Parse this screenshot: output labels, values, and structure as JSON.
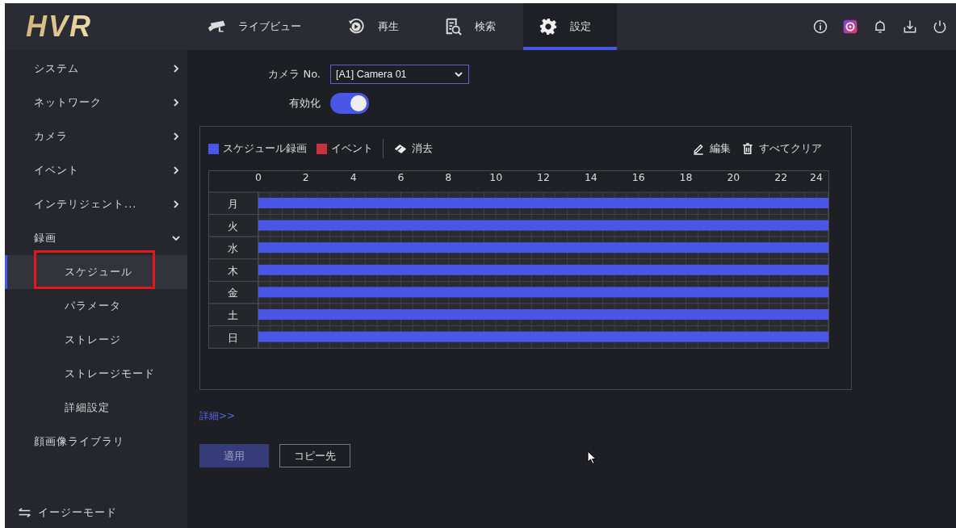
{
  "header": {
    "logo": "HVR",
    "tabs": [
      {
        "kind": "live",
        "label": "ライブビュー",
        "selected": false
      },
      {
        "kind": "playback",
        "label": "再生",
        "selected": false
      },
      {
        "kind": "search",
        "label": "検索",
        "selected": false
      },
      {
        "kind": "settings",
        "label": "設定",
        "selected": true
      }
    ]
  },
  "sidebar": {
    "items": [
      {
        "label": "システム",
        "kind": "group",
        "expanded": false
      },
      {
        "label": "ネットワーク",
        "kind": "group",
        "expanded": false
      },
      {
        "label": "カメラ",
        "kind": "group",
        "expanded": false
      },
      {
        "label": "イベント",
        "kind": "group",
        "expanded": false
      },
      {
        "label": "インテリジェント...",
        "kind": "group",
        "expanded": false
      },
      {
        "label": "録画",
        "kind": "group",
        "expanded": true,
        "children": [
          {
            "label": "スケジュール",
            "selected": true
          },
          {
            "label": "パラメータ",
            "selected": false
          },
          {
            "label": "ストレージ",
            "selected": false
          },
          {
            "label": "ストレージモード",
            "selected": false
          },
          {
            "label": "詳細設定",
            "selected": false
          }
        ]
      },
      {
        "label": "顔画像ライブラリ",
        "kind": "link"
      }
    ],
    "footer": "イージーモード"
  },
  "form": {
    "camera_label": "カメラ No.",
    "camera_value": "[A1] Camera 01",
    "enable_label": "有効化",
    "enabled": true
  },
  "schedule": {
    "legend_extra": [
      {
        "label": "イベント",
        "color": "#c8323c"
      }
    ],
    "erase": "消去",
    "edit": "編集",
    "clear_all": "すべてクリア",
    "chart_data": {
      "type": "bar",
      "orientation": "horizontal",
      "categories": [
        "月",
        "火",
        "水",
        "木",
        "金",
        "土",
        "日"
      ],
      "series": [
        {
          "name": "スケジュール録画",
          "color": "#4a57e6",
          "values": [
            24,
            24,
            24,
            24,
            24,
            24,
            24
          ]
        }
      ],
      "grid": true,
      "xlim": [
        0,
        24
      ],
      "xticks": [
        0,
        2,
        4,
        6,
        8,
        10,
        12,
        14,
        16,
        18,
        20,
        22,
        24
      ]
    }
  },
  "details_link": "詳細>>",
  "buttons": [
    {
      "label": "適用",
      "kind": "primary",
      "disabled": true
    },
    {
      "label": "コピー先",
      "kind": "outline",
      "disabled": false
    }
  ]
}
